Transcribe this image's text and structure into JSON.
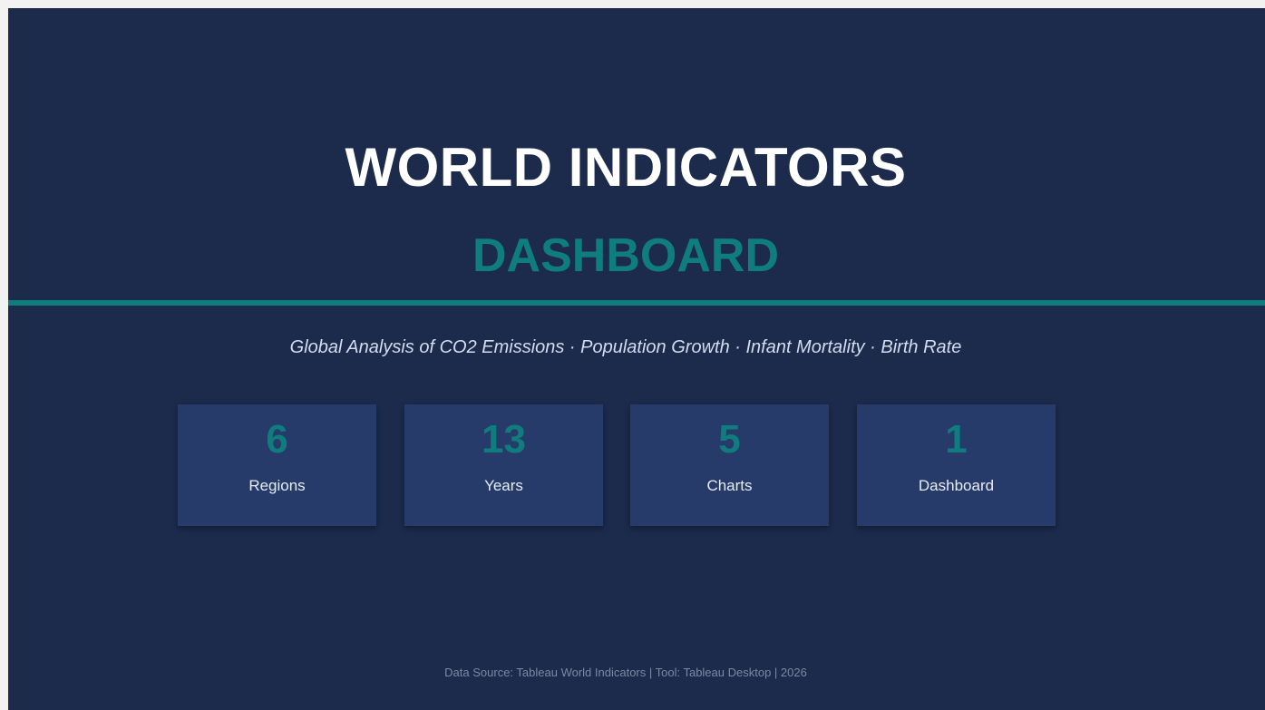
{
  "header": {
    "title": "WORLD INDICATORS",
    "subtitle": "DASHBOARD",
    "tagline": "Global Analysis of CO2 Emissions · Population Growth · Infant Mortality · Birth Rate"
  },
  "stats": [
    {
      "value": "6",
      "label": "Regions"
    },
    {
      "value": "13",
      "label": "Years"
    },
    {
      "value": "5",
      "label": "Charts"
    },
    {
      "value": "1",
      "label": "Dashboard"
    }
  ],
  "footer": {
    "text": "Data Source: Tableau World Indicators  |  Tool: Tableau Desktop  |  2026"
  },
  "colors": {
    "background": "#1c2a4c",
    "accent": "#0f7d7e",
    "card": "#263b69",
    "title": "#ffffff"
  }
}
